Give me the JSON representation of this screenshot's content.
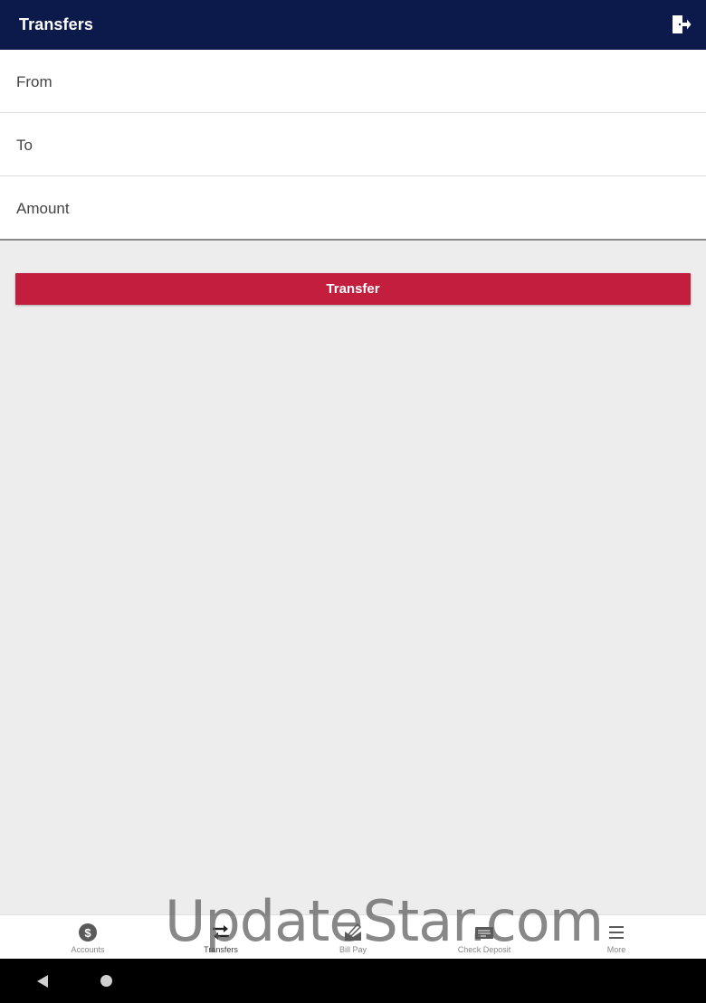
{
  "app_bar": {
    "title": "Transfers",
    "logout_icon": "logout-icon"
  },
  "form": {
    "from_label": "From",
    "to_label": "To",
    "amount_label": "Amount"
  },
  "transfer_button_label": "Transfer",
  "bottom_nav": [
    {
      "label": "Accounts",
      "icon": "dollar-circle-icon"
    },
    {
      "label": "Transfers",
      "icon": "swap-arrows-icon",
      "active": true
    },
    {
      "label": "Bill Pay",
      "icon": "envelope-pen-icon"
    },
    {
      "label": "Check Deposit",
      "icon": "check-icon"
    },
    {
      "label": "More",
      "icon": "menu-icon"
    }
  ],
  "watermark": "UpdateStar.com",
  "colors": {
    "app_bar": "#0b1a4a",
    "accent": "#c41e3f",
    "background": "#ededed"
  }
}
